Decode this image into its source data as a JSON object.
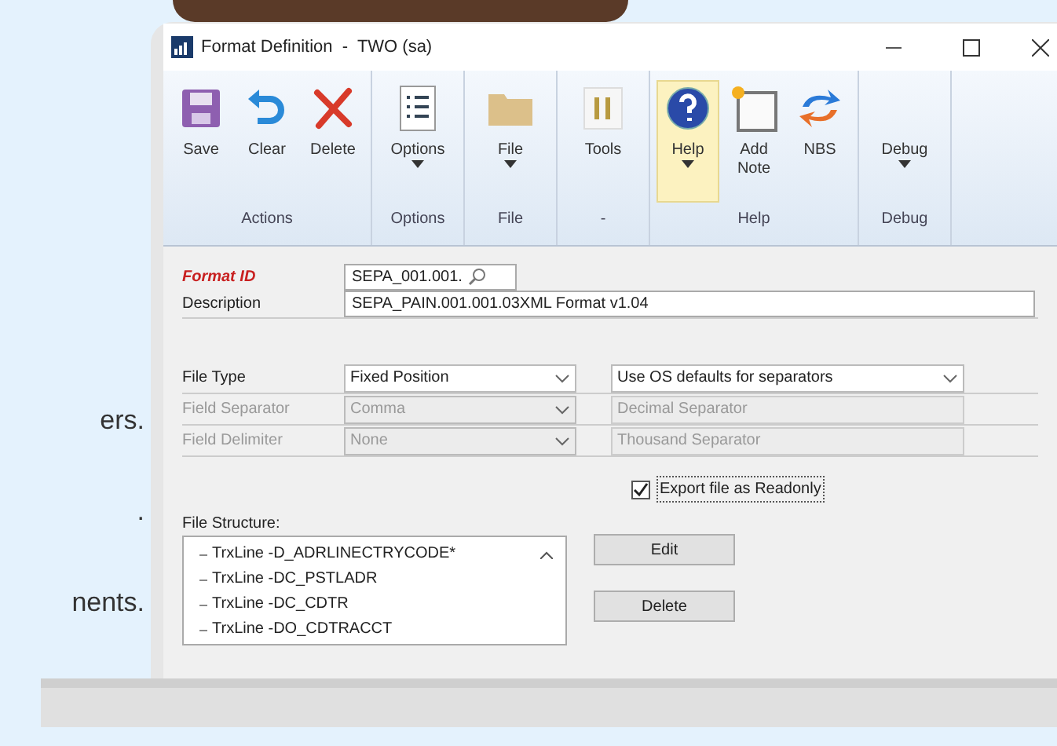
{
  "side_text": [
    "ers.",
    ".",
    "nents."
  ],
  "window": {
    "title": "Format Definition  -  TWO (sa)"
  },
  "ribbon": {
    "groups": [
      {
        "label": "Actions",
        "buttons": [
          {
            "label": "Save",
            "kind": "save",
            "has_menu": false,
            "selected": false
          },
          {
            "label": "Clear",
            "kind": "undo",
            "has_menu": false,
            "selected": false
          },
          {
            "label": "Delete",
            "kind": "delete",
            "has_menu": false,
            "selected": false
          }
        ]
      },
      {
        "label": "Options",
        "buttons": [
          {
            "label": "Options",
            "kind": "list",
            "has_menu": true,
            "selected": false
          }
        ]
      },
      {
        "label": "File",
        "buttons": [
          {
            "label": "File",
            "kind": "folder",
            "has_menu": true,
            "selected": false
          }
        ]
      },
      {
        "label": "-",
        "buttons": [
          {
            "label": "Tools",
            "kind": "tools",
            "has_menu": false,
            "selected": false
          }
        ]
      },
      {
        "label": "Help",
        "buttons": [
          {
            "label": "Help",
            "kind": "help",
            "has_menu": true,
            "selected": true
          },
          {
            "label": "Add Note",
            "kind": "note",
            "has_menu": false,
            "selected": false
          },
          {
            "label": "NBS",
            "kind": "sync",
            "has_menu": false,
            "selected": false
          }
        ]
      },
      {
        "label": "Debug",
        "buttons": [
          {
            "label": "Debug",
            "kind": "text",
            "has_menu": true,
            "selected": false
          }
        ]
      }
    ]
  },
  "form": {
    "format_id": {
      "label": "Format ID",
      "value": "SEPA_001.001."
    },
    "description": {
      "label": "Description",
      "value": "SEPA_PAIN.001.001.03XML Format v1.04"
    },
    "rows": [
      {
        "label": "File Type",
        "value": "Fixed Position",
        "disabled": false,
        "right_value": "Use OS defaults for separators",
        "kind": "select"
      },
      {
        "label": "Field Separator",
        "value": "Comma",
        "disabled": true,
        "right_value": "Decimal Separator",
        "kind": "field"
      },
      {
        "label": "Field Delimiter",
        "value": "None",
        "disabled": true,
        "right_value": "Thousand Separator",
        "kind": "field"
      }
    ],
    "export_readonly": {
      "label": "Export file as Readonly",
      "checked": true
    },
    "file_structure": {
      "label": "File Structure:",
      "items": [
        "TrxLine -D_ADRLINECTRYCODE*",
        "TrxLine -DC_PSTLADR",
        "TrxLine -DC_CDTR",
        "TrxLine -DO_CDTRACCT"
      ]
    },
    "buttons": [
      "Edit",
      "Delete"
    ]
  }
}
